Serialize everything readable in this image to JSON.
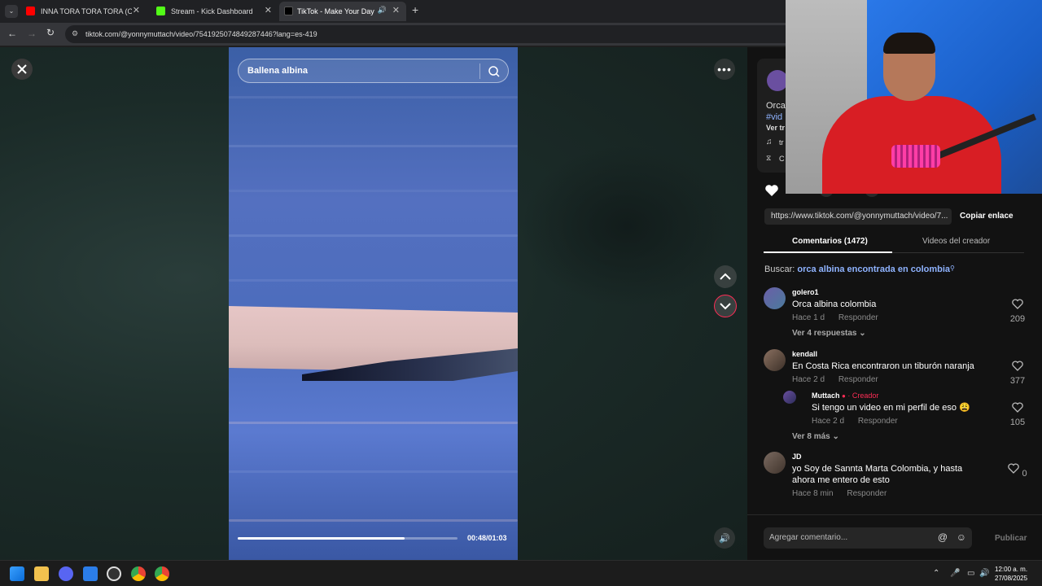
{
  "browser": {
    "tabs": [
      {
        "title": "INNA TORA TORA TORA (ORIGI",
        "favicon_color": "#ff0000"
      },
      {
        "title": "Stream - Kick Dashboard",
        "favicon_color": "#53fc18"
      },
      {
        "title": "TikTok - Make Your Day",
        "favicon_color": "#000000"
      }
    ],
    "new_tab_label": "+",
    "url": "tiktok.com/@yonnymuttach/video/7541925074849287446?lang=es-419"
  },
  "video": {
    "search_value": "Ballena albina",
    "time": "00:48/01:03",
    "progress_fraction": 0.76
  },
  "panel": {
    "card": {
      "title_fragment": "Orca",
      "hashtag_fragment": "#vid",
      "see_more_fragment": "Ver tr",
      "music_fragment": "tr",
      "cap_fragment": "C"
    },
    "link": "https://www.tiktok.com/@yonnymuttach/video/7...",
    "copy_link": "Copiar enlace",
    "tab_comments": "Comentarios (1472)",
    "tab_creator_videos": "Videos del creador",
    "search_prefix": "Buscar:",
    "search_term": "orca albina encontrada en colombia",
    "comments": [
      {
        "user": "golero1",
        "text": "Orca albina colombia",
        "time": "Hace 1 d",
        "reply": "Responder",
        "likes": "209",
        "view_replies": "Ver 4 respuestas"
      },
      {
        "user": "kendall",
        "text": "En Costa Rica encontraron un tiburón naranja",
        "time": "Hace 2 d",
        "reply": "Responder",
        "likes": "377"
      },
      {
        "user": "Muttach",
        "badge": "· Creador",
        "text": "Si tengo un video en mi perfil de eso 😩",
        "time": "Hace 2 d",
        "reply": "Responder",
        "likes": "105",
        "view_replies": "Ver 8 más"
      },
      {
        "user": "JD",
        "text": "yo Soy de Sannta Marta Colombia, y hasta ahora me entero de esto",
        "time": "Hace 8 min",
        "reply": "Responder",
        "likes": "0"
      }
    ],
    "add_comment_placeholder": "Agregar comentario...",
    "publish": "Publicar"
  },
  "taskbar": {
    "time": "12:00 a. m.",
    "date": "27/08/2025"
  },
  "colors": {
    "accent": "#fe2c55",
    "link": "#8fb3ff"
  }
}
